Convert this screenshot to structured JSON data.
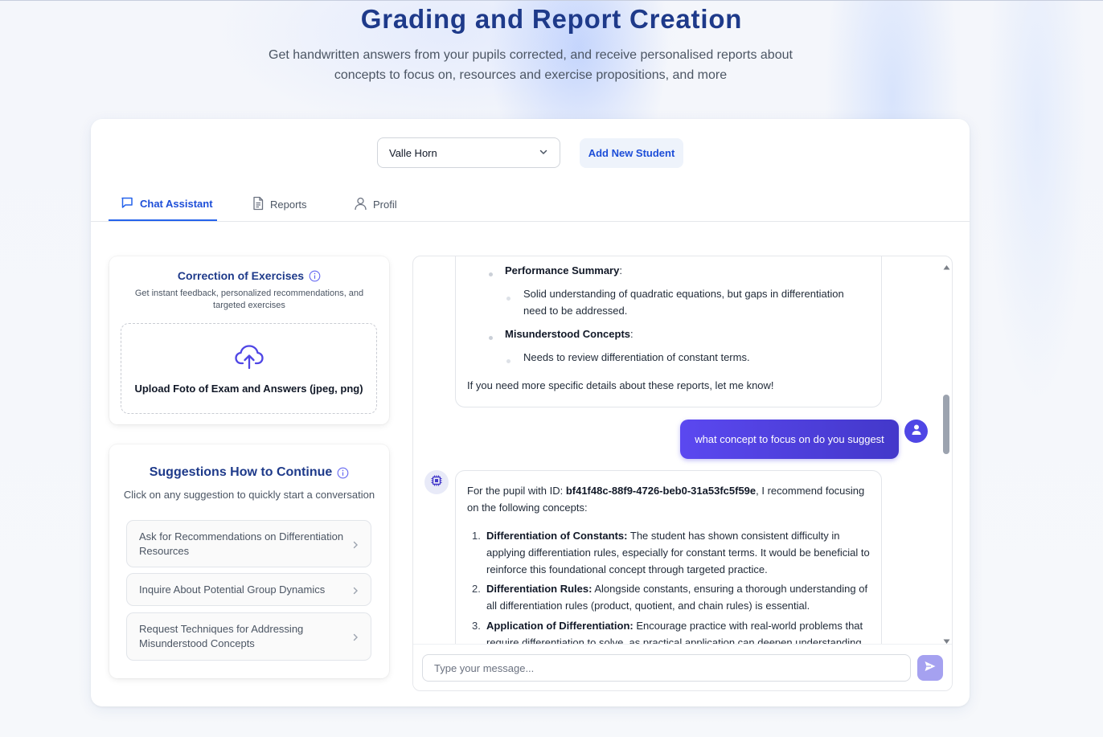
{
  "hero": {
    "title": "Grading and Report Creation",
    "subtitle": "Get handwritten answers from your pupils corrected, and receive personalised reports about concepts to focus on, resources and exercise propositions, and more"
  },
  "student_select": {
    "value": "Valle Horn",
    "icon": "chevron-down-icon"
  },
  "add_student_label": "Add New Student",
  "tabs": [
    {
      "label": "Chat Assistant",
      "icon": "chat-bubble-icon",
      "active": true
    },
    {
      "label": "Reports",
      "icon": "document-icon",
      "active": false
    },
    {
      "label": "Profil",
      "icon": "user-icon",
      "active": false
    }
  ],
  "correction": {
    "title": "Correction of Exercises",
    "description": "Get instant feedback, personalized recommendations, and targeted exercises",
    "upload_label": "Upload Foto of Exam and Answers (jpeg, png)"
  },
  "suggestions": {
    "title": "Suggestions How to Continue",
    "description": "Click on any suggestion to quickly start a conversation",
    "items": [
      "Ask for Recommendations on Differentiation Resources",
      "Inquire About Potential Group Dynamics",
      "Request Techniques for Addressing Misunderstood Concepts"
    ]
  },
  "chat": {
    "prev_message": {
      "performance_label": "Performance Summary",
      "performance_text": "Solid understanding of quadratic equations, but gaps in differentiation need to be addressed.",
      "misunderstood_label": "Misunderstood Concepts",
      "misunderstood_text": "Needs to review differentiation of constant terms.",
      "closing": "If you need more specific details about these reports, let me know!"
    },
    "user_message": "what concept to focus on do you suggest",
    "reply": {
      "intro_pre": "For the pupil with ID: ",
      "pupil_id": "bf41f48c-88f9-4726-beb0-31a53fc5f59e",
      "intro_post": ", I recommend focusing on the following concepts:",
      "items": [
        {
          "num": "1.",
          "title": "Differentiation of Constants:",
          "text": "The student has shown consistent difficulty in applying differentiation rules, especially for constant terms. It would be beneficial to reinforce this foundational concept through targeted practice."
        },
        {
          "num": "2.",
          "title": "Differentiation Rules:",
          "text": "Alongside constants, ensuring a thorough understanding of all differentiation rules (product, quotient, and chain rules) is essential."
        },
        {
          "num": "3.",
          "title": "Application of Differentiation:",
          "text": "Encourage practice with real-world problems that require differentiation to solve, as practical application can deepen understanding."
        }
      ]
    },
    "input_placeholder": "Type your message...",
    "send_icon": "send-icon"
  },
  "colors": {
    "title": "#1e3a8a",
    "accent": "#2563eb",
    "user_bubble": "#4f46e5",
    "send_button": "#a5a1f0"
  }
}
